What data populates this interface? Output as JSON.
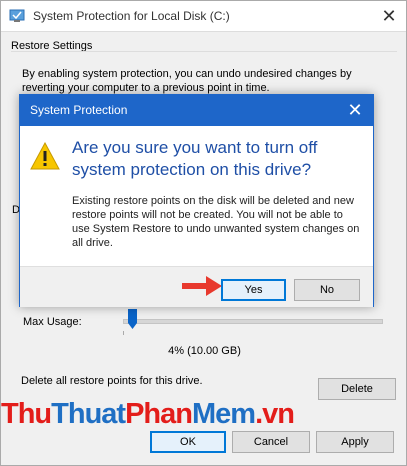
{
  "window": {
    "title": "System Protection for Local Disk (C:)",
    "close": "✕"
  },
  "restore_settings": {
    "heading": "Restore Settings",
    "description": "By enabling system protection, you can undo undesired changes by reverting your computer to a previous point in time.",
    "d_fragment": "D"
  },
  "disk_space": {
    "max_usage_label": "Max Usage:",
    "slider_value_fraction": 0.04,
    "usage_text": "4% (10.00 GB)",
    "delete_label": "Delete all restore points for this drive.",
    "delete_button": "Delete"
  },
  "footer": {
    "ok": "OK",
    "cancel": "Cancel",
    "apply": "Apply"
  },
  "dialog": {
    "title": "System Protection",
    "close": "✕",
    "question": "Are you sure you want to turn off system protection on this drive?",
    "body": "Existing restore points on the disk will be deleted and new restore points will not be created. You will not be able to use System Restore to undo unwanted system changes on all drive.",
    "yes": "Yes",
    "no": "No"
  },
  "watermark": {
    "part1": "Thu",
    "part2": "Thuat",
    "part3": "Phan",
    "part4": "Mem",
    "part5": ".vn"
  },
  "colors": {
    "accent": "#1e66c9",
    "question_text": "#1f4fa6",
    "watermark_red": "#e31d1a",
    "watermark_blue": "#1f6fc4"
  }
}
